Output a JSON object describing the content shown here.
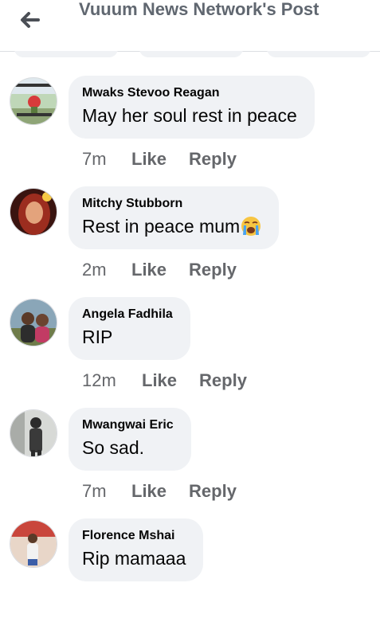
{
  "header": {
    "title": "Vuuum News Network's Post"
  },
  "comments": [
    {
      "author": "Mwaks Stevoo Reagan",
      "text": "May her soul rest in peace",
      "time": "7m",
      "like": "Like",
      "reply": "Reply"
    },
    {
      "author": "Mitchy Stubborn",
      "text": "Rest in peace mum",
      "emoji": "crying-face-emoji",
      "time": "2m",
      "like": "Like",
      "reply": "Reply"
    },
    {
      "author": "Angela Fadhila",
      "text": "RIP",
      "time": "12m",
      "like": "Like",
      "reply": "Reply"
    },
    {
      "author": "Mwangwai Eric",
      "text": "So sad.",
      "time": "7m",
      "like": "Like",
      "reply": "Reply"
    },
    {
      "author": "Florence Mshai",
      "text": "Rip mamaaa"
    }
  ],
  "icons": {
    "back": "arrow-left-icon"
  },
  "colors": {
    "bubble": "#f0f2f5",
    "secondary_text": "#65676b",
    "header_text": "#606770"
  }
}
